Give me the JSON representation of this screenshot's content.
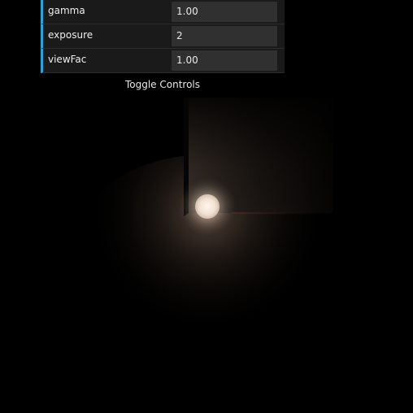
{
  "controls": [
    {
      "label": "gamma",
      "value": "1.00"
    },
    {
      "label": "exposure",
      "value": "2"
    },
    {
      "label": "viewFac",
      "value": "1.00"
    }
  ],
  "toggle_label": "Toggle Controls",
  "colors": {
    "accent": "#2fa1d6",
    "panel_bg": "#1a1a1a",
    "field_bg": "#303030",
    "scene_bg": "#000000",
    "light": "#fff4e8"
  }
}
